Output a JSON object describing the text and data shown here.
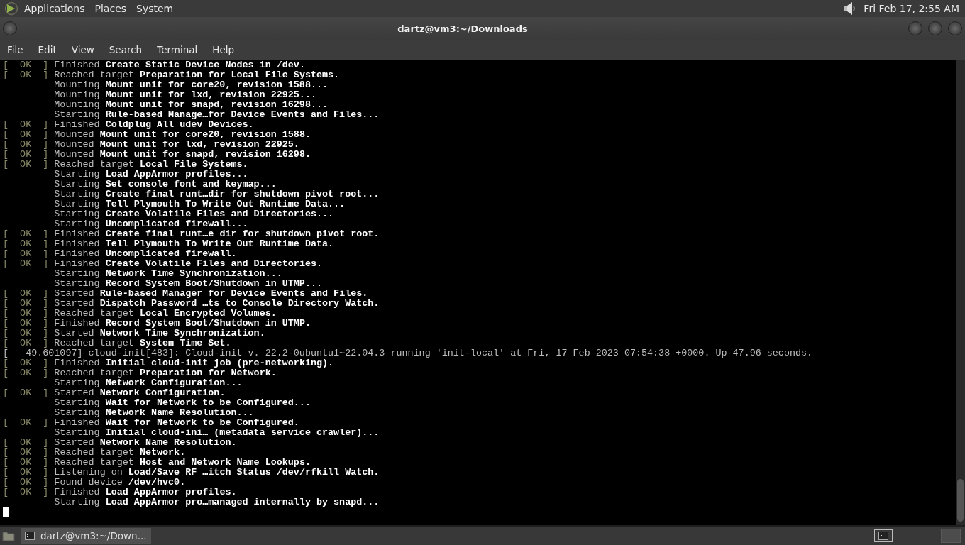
{
  "top_panel": {
    "menus": [
      {
        "label": "Applications"
      },
      {
        "label": "Places"
      },
      {
        "label": "System"
      }
    ],
    "clock": "Fri Feb 17,  2:55 AM"
  },
  "window": {
    "title": "dartz@vm3:~/Downloads"
  },
  "menu_bar": [
    {
      "label": "File"
    },
    {
      "label": "Edit"
    },
    {
      "label": "View"
    },
    {
      "label": "Search"
    },
    {
      "label": "Terminal"
    },
    {
      "label": "Help"
    }
  ],
  "terminal": {
    "lines": [
      {
        "kind": "ok",
        "status": "[  OK  ]",
        "verb": "Finished",
        "subject": "Create Static Device Nodes in /dev."
      },
      {
        "kind": "ok",
        "status": "[  OK  ]",
        "verb": "Reached target",
        "subject": "Preparation for Local File Systems."
      },
      {
        "kind": "job",
        "verb": "Mounting",
        "subject": "Mount unit for core20, revision 1588..."
      },
      {
        "kind": "job",
        "verb": "Mounting",
        "subject": "Mount unit for lxd, revision 22925..."
      },
      {
        "kind": "job",
        "verb": "Mounting",
        "subject": "Mount unit for snapd, revision 16298..."
      },
      {
        "kind": "job",
        "verb": "Starting",
        "subject": "Rule-based Manage…for Device Events and Files..."
      },
      {
        "kind": "ok",
        "status": "[  OK  ]",
        "verb": "Finished",
        "subject": "Coldplug All udev Devices."
      },
      {
        "kind": "ok",
        "status": "[  OK  ]",
        "verb": "Mounted",
        "subject": "Mount unit for core20, revision 1588."
      },
      {
        "kind": "ok",
        "status": "[  OK  ]",
        "verb": "Mounted",
        "subject": "Mount unit for lxd, revision 22925."
      },
      {
        "kind": "ok",
        "status": "[  OK  ]",
        "verb": "Mounted",
        "subject": "Mount unit for snapd, revision 16298."
      },
      {
        "kind": "ok",
        "status": "[  OK  ]",
        "verb": "Reached target",
        "subject": "Local File Systems."
      },
      {
        "kind": "job",
        "verb": "Starting",
        "subject": "Load AppArmor profiles..."
      },
      {
        "kind": "job",
        "verb": "Starting",
        "subject": "Set console font and keymap..."
      },
      {
        "kind": "job",
        "verb": "Starting",
        "subject": "Create final runt…dir for shutdown pivot root..."
      },
      {
        "kind": "job",
        "verb": "Starting",
        "subject": "Tell Plymouth To Write Out Runtime Data..."
      },
      {
        "kind": "job",
        "verb": "Starting",
        "subject": "Create Volatile Files and Directories..."
      },
      {
        "kind": "job",
        "verb": "Starting",
        "subject": "Uncomplicated firewall..."
      },
      {
        "kind": "ok",
        "status": "[  OK  ]",
        "verb": "Finished",
        "subject": "Create final runt…e dir for shutdown pivot root."
      },
      {
        "kind": "ok",
        "status": "[  OK  ]",
        "verb": "Finished",
        "subject": "Tell Plymouth To Write Out Runtime Data."
      },
      {
        "kind": "ok",
        "status": "[  OK  ]",
        "verb": "Finished",
        "subject": "Uncomplicated firewall."
      },
      {
        "kind": "ok",
        "status": "[  OK  ]",
        "verb": "Finished",
        "subject": "Create Volatile Files and Directories."
      },
      {
        "kind": "job",
        "verb": "Starting",
        "subject": "Network Time Synchronization..."
      },
      {
        "kind": "job",
        "verb": "Starting",
        "subject": "Record System Boot/Shutdown in UTMP..."
      },
      {
        "kind": "ok",
        "status": "[  OK  ]",
        "verb": "Started",
        "subject": "Rule-based Manager for Device Events and Files."
      },
      {
        "kind": "ok",
        "status": "[  OK  ]",
        "verb": "Started",
        "subject": "Dispatch Password …ts to Console Directory Watch."
      },
      {
        "kind": "ok",
        "status": "[  OK  ]",
        "verb": "Reached target",
        "subject": "Local Encrypted Volumes."
      },
      {
        "kind": "ok",
        "status": "[  OK  ]",
        "verb": "Finished",
        "subject": "Record System Boot/Shutdown in UTMP."
      },
      {
        "kind": "ok",
        "status": "[  OK  ]",
        "verb": "Started",
        "subject": "Network Time Synchronization."
      },
      {
        "kind": "ok",
        "status": "[  OK  ]",
        "verb": "Reached target",
        "subject": "System Time Set."
      },
      {
        "kind": "log",
        "text": "[   49.601097] cloud-init[483]: Cloud-init v. 22.2-0ubuntu1~22.04.3 running 'init-local' at Fri, 17 Feb 2023 07:54:38 +0000. Up 47.96 seconds."
      },
      {
        "kind": "ok",
        "status": "[  OK  ]",
        "verb": "Finished",
        "subject": "Initial cloud-init job (pre-networking)."
      },
      {
        "kind": "ok",
        "status": "[  OK  ]",
        "verb": "Reached target",
        "subject": "Preparation for Network."
      },
      {
        "kind": "job",
        "verb": "Starting",
        "subject": "Network Configuration..."
      },
      {
        "kind": "ok",
        "status": "[  OK  ]",
        "verb": "Started",
        "subject": "Network Configuration."
      },
      {
        "kind": "job",
        "verb": "Starting",
        "subject": "Wait for Network to be Configured..."
      },
      {
        "kind": "job",
        "verb": "Starting",
        "subject": "Network Name Resolution..."
      },
      {
        "kind": "ok",
        "status": "[  OK  ]",
        "verb": "Finished",
        "subject": "Wait for Network to be Configured."
      },
      {
        "kind": "job",
        "verb": "Starting",
        "subject": "Initial cloud-ini… (metadata service crawler)..."
      },
      {
        "kind": "ok",
        "status": "[  OK  ]",
        "verb": "Started",
        "subject": "Network Name Resolution."
      },
      {
        "kind": "ok",
        "status": "[  OK  ]",
        "verb": "Reached target",
        "subject": "Network."
      },
      {
        "kind": "ok",
        "status": "[  OK  ]",
        "verb": "Reached target",
        "subject": "Host and Network Name Lookups."
      },
      {
        "kind": "ok",
        "status": "[  OK  ]",
        "verb": "Listening on",
        "subject": "Load/Save RF …itch Status /dev/rfkill Watch."
      },
      {
        "kind": "ok",
        "status": "[  OK  ]",
        "verb": "Found device",
        "subject": "/dev/hvc0."
      },
      {
        "kind": "ok",
        "status": "[  OK  ]",
        "verb": "Finished",
        "subject": "Load AppArmor profiles."
      },
      {
        "kind": "job",
        "verb": "Starting",
        "subject": "Load AppArmor pro…managed internally by snapd..."
      }
    ]
  },
  "taskbar": {
    "tasks": [
      {
        "label": "dartz@vm3:~/Down...",
        "selected": true
      }
    ]
  }
}
